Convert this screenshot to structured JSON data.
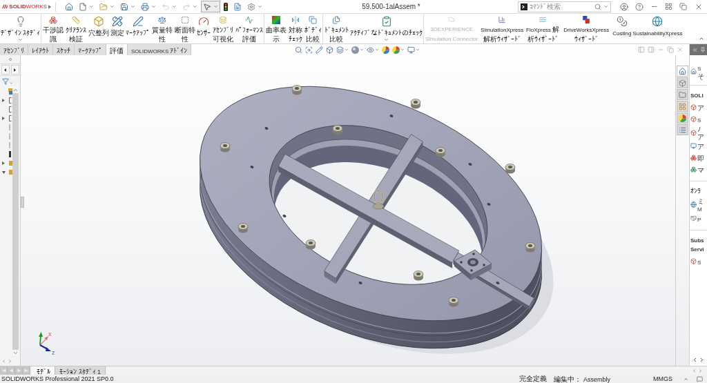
{
  "title_bar": {
    "logo": "**SOLID**WORKS",
    "quick_access": [
      {
        "dropdown": false,
        "disabled": false,
        "selected": false
      },
      {
        "dropdown": true,
        "disabled": false,
        "selected": false
      },
      {
        "dropdown": true,
        "disabled": false,
        "selected": false
      },
      {
        "dropdown": true,
        "disabled": false,
        "selected": false
      },
      {
        "dropdown": true,
        "disabled": false,
        "selected": false
      },
      {
        "dropdown": true,
        "disabled": true,
        "selected": false
      },
      {
        "dropdown": true,
        "disabled": true,
        "selected": false
      },
      {
        "dropdown": true,
        "disabled": false,
        "selected": true
      },
      {
        "dropdown": false,
        "disabled": false,
        "selected": false
      },
      {
        "dropdown": false,
        "disabled": false,
        "selected": false
      },
      {
        "dropdown": true,
        "disabled": false,
        "selected": false
      }
    ],
    "document_title": "59.500-1alAssem *",
    "command_search": {
      "placeholder": "ｺﾏﾝﾄﾞ検索"
    }
  },
  "ribbon": {
    "groups": [
      {
        "items": [
          {
            "label": "ﾃﾞｻﾞｲﾝ ｽﾀﾃﾞｨ",
            "dropdown": true,
            "disabled": false
          }
        ]
      },
      {
        "items": [
          {
            "label": "干渉認識",
            "dropdown": false,
            "disabled": false
          },
          {
            "label": "ｸﾘｱﾗﾝｽ検証",
            "dropdown": false,
            "disabled": false
          },
          {
            "label": "穴整列",
            "dropdown": false,
            "disabled": false
          },
          {
            "label": "測定",
            "dropdown": false,
            "disabled": false
          },
          {
            "label": "ﾏｰｸｱｯﾌﾟ",
            "dropdown": false,
            "disabled": false
          },
          {
            "label": "質量特性",
            "dropdown": false,
            "disabled": false
          },
          {
            "label": "断面特性",
            "dropdown": false,
            "disabled": false
          },
          {
            "label": "ｾﾝｻｰ",
            "dropdown": false,
            "disabled": false
          },
          {
            "label": "ｱｾﾝﾌﾞﾘ可視化",
            "dropdown": false,
            "disabled": false
          },
          {
            "label": "ﾊﾟﾌｫｰﾏﾝｽ評価",
            "dropdown": false,
            "disabled": false
          }
        ]
      },
      {
        "items": [
          {
            "label": "曲率表示",
            "dropdown": false,
            "disabled": false
          },
          {
            "label": "対称ﾁｪｯｸ",
            "dropdown": false,
            "disabled": false
          },
          {
            "label": "ﾎﾞﾃﾞｨ比較",
            "dropdown": false,
            "disabled": false
          }
        ]
      },
      {
        "items": [
          {
            "label": "ﾄﾞｷｭﾒﾝﾄ比較",
            "dropdown": false,
            "disabled": false
          },
          {
            "label": "ｱｸﾃｨﾌﾞなﾄﾞｷｭﾒﾝﾄのﾁｪｯｸ",
            "dropdown": true,
            "disabled": false
          }
        ]
      },
      {
        "items": [
          {
            "label": "3DEXPERIENCE Simulation Connector",
            "dropdown": false,
            "disabled": true
          },
          {
            "label": "SimulationXpress 解析ｳｨｻﾞｰﾄﾞ",
            "dropdown": false,
            "disabled": false
          },
          {
            "label": "FloXpress 解析ｳｨｻﾞｰﾄﾞ",
            "dropdown": false,
            "disabled": false
          },
          {
            "label": "DriveWorksXpress ｳｨｻﾞｰﾄﾞ",
            "dropdown": false,
            "disabled": false
          },
          {
            "label": "Costing",
            "dropdown": false,
            "disabled": false
          },
          {
            "label": "SustainabilityXpress",
            "dropdown": false,
            "disabled": false
          }
        ]
      }
    ]
  },
  "command_tabs": [
    {
      "label": "ｱｾﾝﾌﾞﾘ",
      "selected": false
    },
    {
      "label": "ﾚｲｱｳﾄ",
      "selected": false
    },
    {
      "label": "ｽｹｯﾁ",
      "selected": false
    },
    {
      "label": "ﾏｰｸｱｯﾌﾟ",
      "selected": false
    },
    {
      "label": "評価",
      "selected": true
    },
    {
      "label": "SOLIDWORKS ｱﾄﾞｲﾝ",
      "selected": false
    }
  ],
  "feature_tree": {
    "rows": [
      {
        "kind": "assembly"
      },
      {
        "kind": "folder",
        "expanded": false
      },
      {
        "kind": "folder"
      },
      {
        "kind": "folder",
        "expanded": false
      },
      {
        "kind": "plane"
      },
      {
        "kind": "plane"
      },
      {
        "kind": "plane"
      },
      {
        "kind": "origin"
      },
      {
        "kind": "part",
        "expanded": false
      },
      {
        "kind": "part",
        "expanded": true
      }
    ]
  },
  "triad": {
    "x_label": "x",
    "z_label": "z"
  },
  "task_pane": {
    "tabs": [
      {
        "selected": true
      },
      {
        "selected": false
      },
      {
        "selected": false
      },
      {
        "selected": false
      },
      {
        "selected": false
      },
      {
        "selected": false
      }
    ],
    "home_link": {
      "lines": [
        "S",
        "そ"
      ]
    },
    "sections": [
      {
        "title_lines": [
          "SOLI"
        ],
        "items": [
          {
            "lines": [
              "ア"
            ]
          },
          {
            "lines": [
              "S"
            ]
          },
          {
            "lines": [
              "ﾉ",
              "ア"
            ]
          },
          {
            "lines": [
              "ア"
            ]
          },
          {
            "lines": [
              "即"
            ]
          },
          {
            "lines": [
              "マ"
            ]
          }
        ]
      },
      {
        "title_lines": [
          "ｵﾝﾗ"
        ],
        "items": [
          {
            "lines": [
              "ミ",
              "M"
            ]
          },
          {
            "lines": [
              "P"
            ]
          }
        ]
      },
      {
        "title_lines": [
          "Subs",
          "Servi"
        ],
        "items": [
          {
            "lines": [
              "S"
            ]
          }
        ]
      }
    ]
  },
  "bottom_tabs": [
    {
      "label": "ﾓﾃﾞﾙ",
      "selected": true
    },
    {
      "label": "ﾓｰｼｮﾝ ｽﾀﾃﾞｨ 1",
      "selected": false
    }
  ],
  "status_bar": {
    "product": "SOLIDWORKS Professional 2021 SP0.0",
    "definition": "完全定義",
    "editing": "編集中： Assembly",
    "units": "MMGS"
  }
}
